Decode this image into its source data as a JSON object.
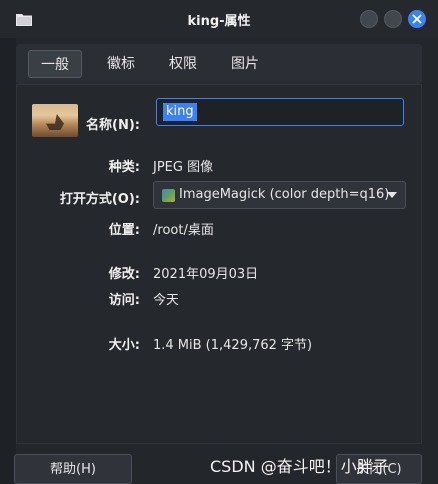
{
  "window": {
    "title": "king-属性",
    "icon": "folder-icon",
    "controls": [
      "minimize",
      "maximize",
      "close"
    ],
    "accent_color": "#3b82f6"
  },
  "tabs": [
    {
      "label": "一般",
      "active": true
    },
    {
      "label": "徽标",
      "active": false
    },
    {
      "label": "权限",
      "active": false
    },
    {
      "label": "图片",
      "active": false
    }
  ],
  "general": {
    "name_label": "名称(N):",
    "name_value": "king",
    "type_label": "种类:",
    "type_value": "JPEG 图像",
    "open_with_label": "打开方式(O):",
    "open_with_value": "ImageMagick (color depth=q16)",
    "location_label": "位置:",
    "location_value": "/root/桌面",
    "modified_label": "修改:",
    "modified_value": "2021年09月03日",
    "accessed_label": "访问:",
    "accessed_value": "今天",
    "size_label": "大小:",
    "size_value": "1.4 MiB (1,429,762 字节)"
  },
  "buttons": {
    "help": "帮助(H)",
    "close": "关闭(C)"
  },
  "watermark": "CSDN @奋斗吧！小胖子"
}
